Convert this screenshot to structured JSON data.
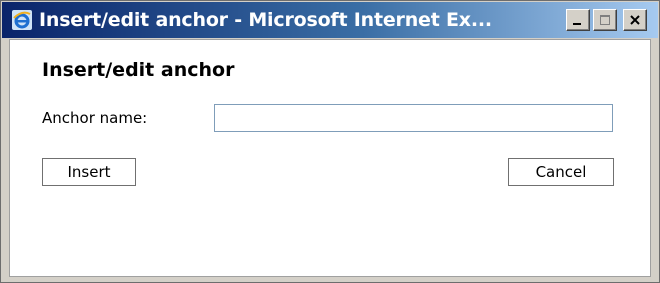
{
  "window": {
    "title": "Insert/edit anchor - Microsoft Internet Ex...",
    "app_icon": "internet-explorer-icon",
    "controls": [
      "minimize-icon",
      "maximize-icon",
      "close-icon"
    ]
  },
  "dialog": {
    "heading": "Insert/edit anchor",
    "anchor_name_label": "Anchor name:",
    "anchor_name_value": "",
    "insert_label": "Insert",
    "cancel_label": "Cancel"
  },
  "colors": {
    "titlebar_start": "#0a246a",
    "titlebar_end": "#a6caf0",
    "input_border": "#7f9db9"
  }
}
